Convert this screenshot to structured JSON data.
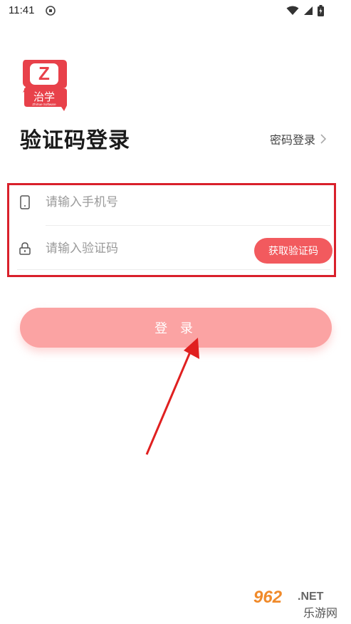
{
  "status_bar": {
    "time": "11:41"
  },
  "logo": {
    "letter": "Z",
    "name_cn": "治学",
    "name_en": "ZhiXue Software"
  },
  "header": {
    "title": "验证码登录",
    "password_login_label": "密码登录"
  },
  "form": {
    "phone_placeholder": "请输入手机号",
    "code_placeholder": "请输入验证码",
    "get_code_label": "获取验证码"
  },
  "login_button_label": "登 录",
  "watermark": {
    "number": "962",
    "suffix": ".NET",
    "cn": "乐游网"
  },
  "colors": {
    "accent": "#f25a5e",
    "login_button": "#fba3a3",
    "highlight_border": "#d9202b"
  }
}
